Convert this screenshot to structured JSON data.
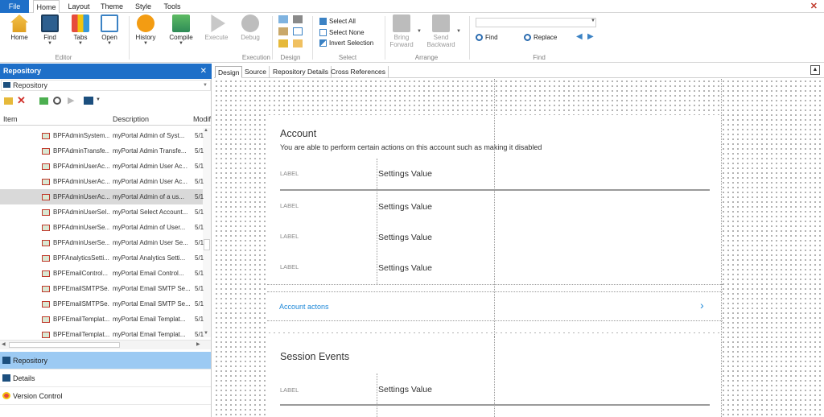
{
  "menu": {
    "file": "File",
    "tabs": [
      "Home",
      "Layout",
      "Theme",
      "Style",
      "Tools"
    ]
  },
  "ribbon": {
    "editor": {
      "buttons": [
        "Home",
        "Find",
        "Tabs",
        "Open"
      ],
      "label": "Editor"
    },
    "execution": {
      "buttons": [
        "History",
        "Compile",
        "Execute",
        "Debug"
      ],
      "label": "Execution"
    },
    "design": {
      "label": "Design"
    },
    "select": {
      "items": [
        "Select All",
        "Select None",
        "Invert Selection"
      ],
      "label": "Select"
    },
    "arrange": {
      "bring_forward": [
        "Bring",
        "Forward"
      ],
      "send_backward": [
        "Send",
        "Backward"
      ],
      "label": "Arrange"
    },
    "find": {
      "find_label": "Find",
      "replace_label": "Replace",
      "label": "Find",
      "search_value": ""
    }
  },
  "repository": {
    "title": "Repository",
    "combo": "Repository",
    "columns": [
      "Item",
      "Description",
      "Modif"
    ],
    "rows": [
      {
        "name": "BPFAdminSystem...",
        "desc": "myPortal Admin of Syst...",
        "mod": "5/1"
      },
      {
        "name": "BPFAdminTransfe...",
        "desc": "myPortal Admin Transfe...",
        "mod": "5/1"
      },
      {
        "name": "BPFAdminUserAc...",
        "desc": "myPortal Admin User Ac...",
        "mod": "5/1"
      },
      {
        "name": "BPFAdminUserAc...",
        "desc": "myPortal Admin User Ac...",
        "mod": "5/1"
      },
      {
        "name": "BPFAdminUserAc...",
        "desc": "myPortal Admin of a us...",
        "mod": "5/1"
      },
      {
        "name": "BPFAdminUserSel...",
        "desc": "myPortal Select Account...",
        "mod": "5/1"
      },
      {
        "name": "BPFAdminUserSe...",
        "desc": "myPortal Admin of User...",
        "mod": "5/1"
      },
      {
        "name": "BPFAdminUserSe...",
        "desc": "myPortal Admin User Se...",
        "mod": "5/1"
      },
      {
        "name": "BPFAnalyticsSetti...",
        "desc": "myPortal Analytics Setti...",
        "mod": "5/1"
      },
      {
        "name": "BPFEmailControl...",
        "desc": "myPortal Email Control...",
        "mod": "5/1"
      },
      {
        "name": "BPFEmailSMTPSe...",
        "desc": "myPortal Email SMTP Se...",
        "mod": "5/1"
      },
      {
        "name": "BPFEmailSMTPSe...",
        "desc": "myPortal Email SMTP Se...",
        "mod": "5/1"
      },
      {
        "name": "BPFEmailTemplat...",
        "desc": "myPortal Email Templat...",
        "mod": "5/1"
      },
      {
        "name": "BPFEmailTemplat...",
        "desc": "myPortal Email Templat...",
        "mod": "5/1"
      }
    ],
    "selected_row": 4,
    "nav": [
      "Repository",
      "Details",
      "Version Control"
    ]
  },
  "doc_tabs": [
    "Design",
    "Source",
    "Repository Details",
    "Cross References"
  ],
  "design": {
    "account": {
      "title": "Account",
      "subtitle": "You are able to perform certain actions on this account such as making it disabled",
      "rows": [
        {
          "label": "LABEL",
          "value": "Settings Value"
        },
        {
          "label": "LABEL",
          "value": "Settings Value"
        },
        {
          "label": "LABEL",
          "value": "Settings Value"
        },
        {
          "label": "LABEL",
          "value": "Settings Value"
        }
      ],
      "actions_link": "Account actons",
      "chevron": "›"
    },
    "session": {
      "title": "Session Events",
      "rows": [
        {
          "label": "LABEL",
          "value": "Settings Value"
        }
      ]
    }
  },
  "colors": {
    "accent": "#1e6fc8",
    "link": "#1e88d8",
    "selected_nav": "#9ccaf3",
    "close": "#c0392b"
  }
}
